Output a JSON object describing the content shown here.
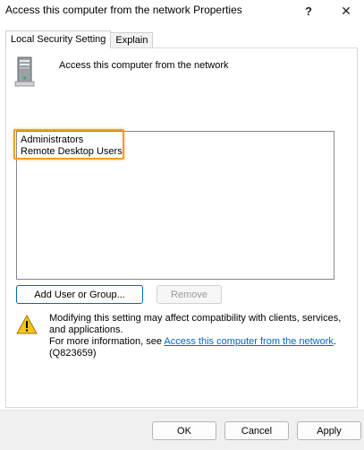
{
  "window": {
    "title": "Access this computer from the network Properties",
    "help_glyph": "?",
    "close_glyph": "✕"
  },
  "tabs": [
    {
      "label": "Local Security Setting",
      "active": true
    },
    {
      "label": "Explain",
      "active": false
    }
  ],
  "policy": {
    "name": "Access this computer from the network",
    "icon": "server-tower-icon"
  },
  "members": [
    "Administrators",
    "Remote Desktop Users"
  ],
  "actions": {
    "add_label": "Add User or Group...",
    "remove_label": "Remove"
  },
  "warning": {
    "icon": "warning-icon",
    "line1": "Modifying this setting may affect compatibility with clients, services, and applications.",
    "more_prefix": "For more information, see ",
    "link_text": "Access this computer from the network",
    "link_suffix": ".",
    "kb": "(Q823659)"
  },
  "footer": {
    "ok_label": "OK",
    "cancel_label": "Cancel",
    "apply_label": "Apply"
  },
  "colors": {
    "highlight": "#f0a020",
    "link": "#0066cc",
    "primary_border": "#0067c0"
  }
}
